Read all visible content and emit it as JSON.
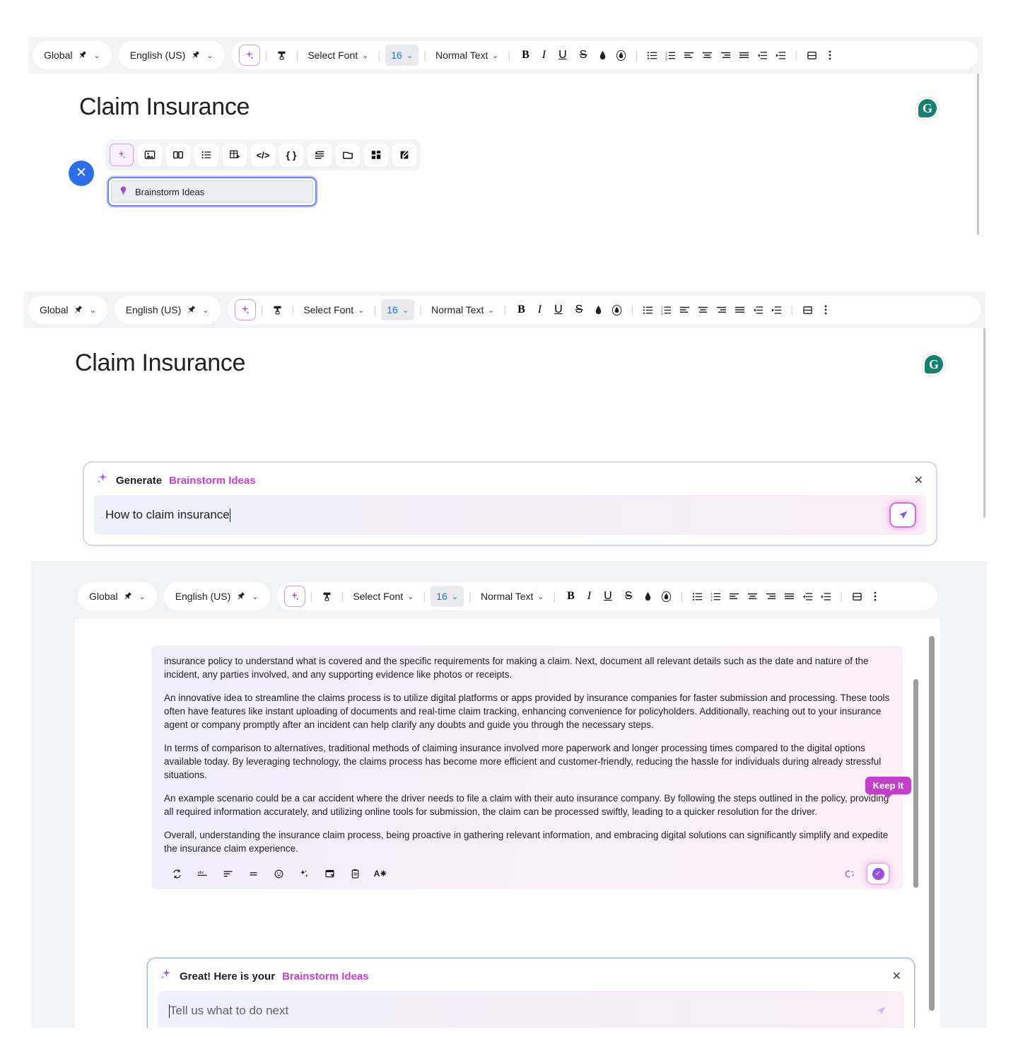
{
  "toolbar": {
    "scope_label": "Global",
    "language_label": "English (US)",
    "ai_icon": "ai-sparkle-icon",
    "format_paint_icon": "format-paint-icon",
    "font_select_label": "Select Font",
    "font_size_label": "16",
    "paragraph_style_label": "Normal Text",
    "bold_label": "B",
    "italic_label": "I",
    "underline_label": "U",
    "strikethrough_label": "S",
    "text_color_icon": "text-color-icon",
    "highlight_icon": "highlight-color-icon",
    "bullet_list_icon": "bulleted-list-icon",
    "numbered_list_icon": "numbered-list-icon",
    "align_left_icon": "align-left-icon",
    "align_center_icon": "align-center-icon",
    "align_right_icon": "align-right-icon",
    "align_justify_icon": "align-justify-icon",
    "outdent_icon": "decrease-indent-icon",
    "indent_icon": "increase-indent-icon",
    "page_break_icon": "insert-page-break-icon",
    "more_icon": "more-options-icon",
    "chevron": "⌄",
    "pin": "📌"
  },
  "document": {
    "title": "Claim Insurance",
    "grammarly_letter": "G",
    "grammarly_name": "grammarly-icon"
  },
  "panel1": {
    "close_label": "✕",
    "ai_tools": [
      {
        "name": "ai-assistant-tool",
        "glyph": "✳",
        "selected": true
      },
      {
        "name": "insert-image-tool",
        "glyph": "image"
      },
      {
        "name": "two-column-tool",
        "glyph": "columns"
      },
      {
        "name": "bulleted-list-tool",
        "glyph": "list"
      },
      {
        "name": "insert-table-tool",
        "glyph": "table"
      },
      {
        "name": "code-block-tool",
        "glyph": "</>"
      },
      {
        "name": "variable-tool",
        "glyph": "{ }"
      },
      {
        "name": "indent-block-tool",
        "glyph": "indent"
      },
      {
        "name": "container-tool",
        "glyph": "card"
      },
      {
        "name": "layout-grid-tool",
        "glyph": "grid"
      },
      {
        "name": "edit-note-tool",
        "glyph": "edit"
      }
    ],
    "menu_item_label": "Brainstorm Ideas",
    "menu_item_icon": "lightbulb-icon"
  },
  "panel2": {
    "card_prefix": "Generate",
    "card_accent": "Brainstorm Ideas",
    "close_label": "✕",
    "input_value": "How to claim insurance",
    "send_icon": "send-paper-plane-icon"
  },
  "panel3": {
    "paragraphs": [
      "insurance policy to understand what is covered and the specific requirements for making a claim. Next, document all relevant details such as the date and nature of the incident, any parties involved, and any supporting evidence like photos or receipts.",
      "An innovative idea to streamline the claims process is to utilize digital platforms or apps provided by insurance companies for faster submission and processing. These tools often have features like instant uploading of documents and real-time claim tracking, enhancing convenience for policyholders. Additionally, reaching out to your insurance agent or company promptly after an incident can help clarify any doubts and guide you through the necessary steps.",
      "In terms of comparison to alternatives, traditional methods of claiming insurance involved more paperwork and longer processing times compared to the digital options available today. By leveraging technology, the claims process has become more efficient and customer-friendly, reducing the hassle for individuals during already stressful situations.",
      "An example scenario could be a car accident where the driver needs to file a claim with their auto insurance company. By following the steps outlined in the policy, providing all required information accurately, and utilizing online tools for submission, the claim can be processed swiftly, leading to a quicker resolution for the driver.",
      "Overall, understanding the insurance claim process, being proactive in gathering relevant information, and embracing digital solutions can significantly simplify and expedite the insurance claim experience."
    ],
    "result_tools": [
      {
        "name": "regenerate-icon",
        "glyph": "regen"
      },
      {
        "name": "spellcheck-icon",
        "glyph": "abc"
      },
      {
        "name": "summarize-icon",
        "glyph": "lines"
      },
      {
        "name": "shorten-icon",
        "glyph": "equals"
      },
      {
        "name": "change-tone-icon",
        "glyph": "smile"
      },
      {
        "name": "improve-icon",
        "glyph": "sparkle"
      },
      {
        "name": "insert-below-icon",
        "glyph": "insert"
      },
      {
        "name": "copy-icon",
        "glyph": "clipboard"
      },
      {
        "name": "rewrite-icon",
        "glyph": "AA"
      }
    ],
    "discard_icon": "discard-icon",
    "keep_tooltip": "Keep It",
    "keep_icon": "keep-it-check-icon",
    "card_prefix": "Great! Here is your",
    "card_accent": "Brainstorm Ideas",
    "close_label": "✕",
    "input_placeholder": "Tell us what to do next",
    "send_icon": "send-paper-plane-icon"
  },
  "colors": {
    "accent_purple": "#c83fd4",
    "blue": "#2b6fe8",
    "grammarly_green": "#15806e",
    "toolbar_bg": "#f1f3f4"
  }
}
